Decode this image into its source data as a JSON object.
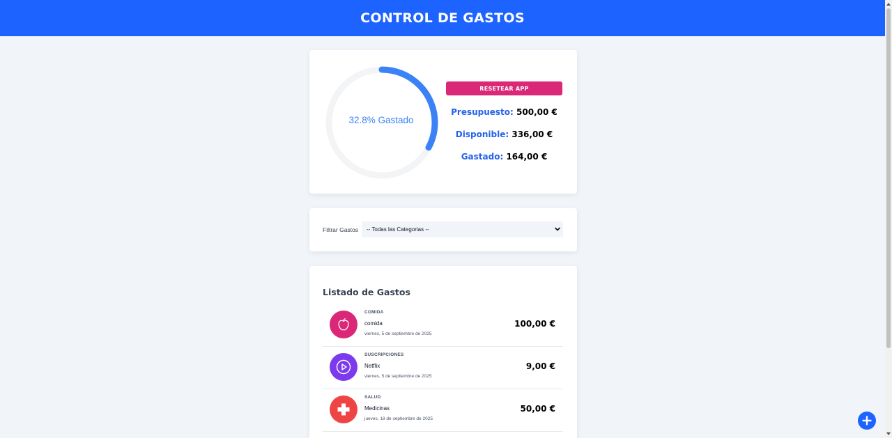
{
  "header": {
    "title": "CONTROL DE GASTOS"
  },
  "budget": {
    "percent_spent": 32.8,
    "progress_label": "32.8% Gastado",
    "reset_label": "RESETEAR APP",
    "presupuesto_label": "Presupuesto:",
    "presupuesto_value": "500,00 €",
    "disponible_label": "Disponible:",
    "disponible_value": "336,00 €",
    "gastado_label": "Gastado:",
    "gastado_value": "164,00 €",
    "colors": {
      "ring": "#3b82f6",
      "track": "#f3f4f6",
      "reset": "#db2777"
    }
  },
  "filter": {
    "label": "Filtrar Gastos",
    "selected": "-- Todas las Categorias --"
  },
  "list": {
    "title": "Listado de Gastos",
    "expenses": [
      {
        "category": "COMIDA",
        "name": "comida",
        "date": "viernes, 5 de septiembre de 2025",
        "amount": "100,00 €",
        "icon": "apple-icon",
        "color": "#db2777"
      },
      {
        "category": "SUSCRIPCIONES",
        "name": "Netflix",
        "date": "viernes, 5 de septiembre de 2025",
        "amount": "9,00 €",
        "icon": "play-icon",
        "color": "#7c3aed"
      },
      {
        "category": "SALUD",
        "name": "Medicinas",
        "date": "jueves, 18 de septiembre de 2025",
        "amount": "50,00 €",
        "icon": "health-cross-icon",
        "color": "#ef4444"
      }
    ]
  },
  "fab": {
    "icon": "plus-icon",
    "color": "#1d63ff"
  }
}
